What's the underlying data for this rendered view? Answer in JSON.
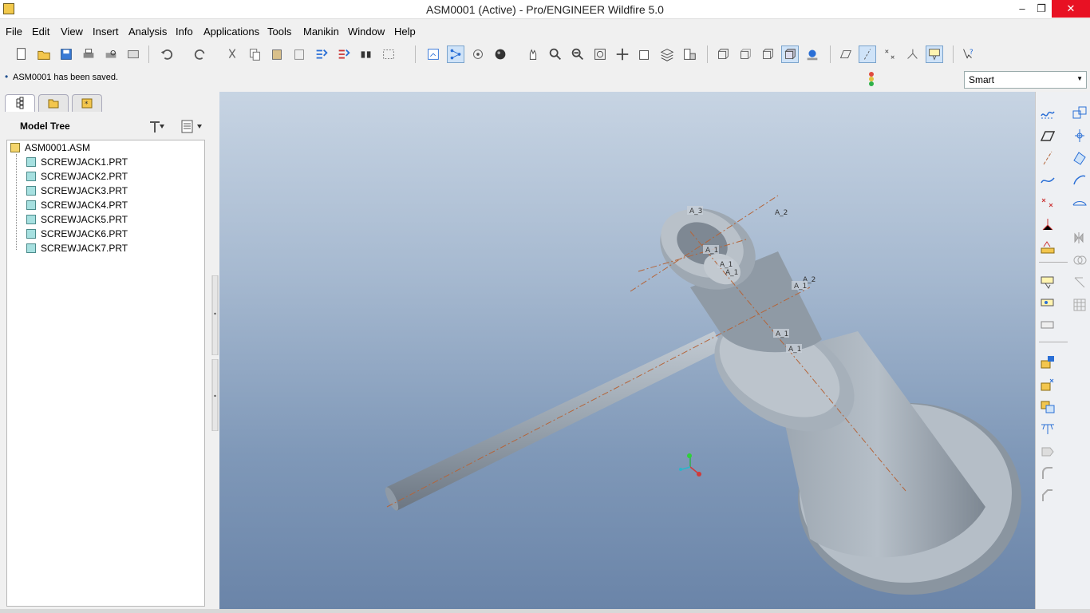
{
  "window": {
    "title": "ASM0001 (Active) - Pro/ENGINEER Wildfire 5.0",
    "min": "–",
    "max": "❐",
    "close": "✕"
  },
  "menu": [
    "File",
    "Edit",
    "View",
    "Insert",
    "Analysis",
    "Info",
    "Applications",
    "Tools",
    "Manikin",
    "Window",
    "Help"
  ],
  "message": {
    "bullet": "•",
    "text": "ASM0001 has been saved."
  },
  "filter": {
    "value": "Smart",
    "arrow": "▼"
  },
  "model_tree": {
    "title": "Model Tree",
    "root": "ASM0001.ASM",
    "items": [
      "SCREWJACK1.PRT",
      "SCREWJACK2.PRT",
      "SCREWJACK3.PRT",
      "SCREWJACK4.PRT",
      "SCREWJACK5.PRT",
      "SCREWJACK6.PRT",
      "SCREWJACK7.PRT"
    ]
  },
  "axis_labels": {
    "a3": "A_3",
    "a2_top": "A_2",
    "a1_a": "A_1",
    "a1_b": "A_1",
    "a1_c": "A_1",
    "a2_mid": "A_2",
    "a1_d": "A_1",
    "a1_e": "A_1",
    "a1_f": "A_1"
  },
  "colors": {
    "accent": "#cfe3f8",
    "viewport_top": "#c7d4e3",
    "viewport_bottom": "#6a84a8",
    "part": "#9aa4ae"
  }
}
